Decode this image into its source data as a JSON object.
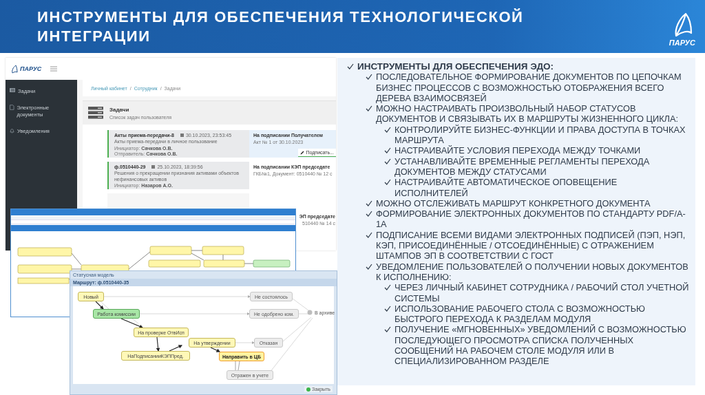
{
  "header": {
    "title": "ИНСТРУМЕНТЫ ДЛЯ ОБЕСПЕЧЕНИЯ ТЕХНОЛОГИЧЕСКОЙ ИНТЕГРАЦИИ",
    "logo_text": "ПАРУС"
  },
  "portal": {
    "logo_text": "ПАРУС",
    "sidebar": [
      {
        "label": "Задачи"
      },
      {
        "label": "Электронные документы"
      },
      {
        "label": "Уведомления"
      }
    ],
    "breadcrumb": [
      "Личный кабинет",
      "Сотрудник",
      "Задачи"
    ],
    "separator": "/",
    "panel": {
      "title": "Задачи",
      "subtitle": "Список задач пользователя"
    },
    "tasks": [
      {
        "title": "Акты приема-передачи-8",
        "date": "30.10.2023, 23:53:45",
        "description": "Акты приема-передачи в личное пользование",
        "fields": [
          {
            "label": "Инициатор:",
            "value": "Сачкова О.В."
          },
          {
            "label": "Отправитель:",
            "value": "Сачкова О.В."
          }
        ],
        "status": "На подписании Получателем",
        "detail": "Акт  № 1 от 30.10.2023",
        "action": "Подписать..."
      },
      {
        "title": "ф.0510440-29",
        "date": "25.10.2023, 18:39:56",
        "description": "Решения о прекращении признания активами объектов нефинансовых активов",
        "fields": [
          {
            "label": "Инициатор:",
            "value": "Назаров А.О."
          }
        ],
        "status": "На подписании КЭП председате",
        "detail": "ГКБ№1, Документ: 0510440 № 12 с"
      },
      {
        "status": "ЭП председате",
        "detail": "510440 № 14 с"
      }
    ]
  },
  "status_window": {
    "title": "Статусная модель",
    "route": "Маршрут: ф.0510440-35",
    "nodes": [
      {
        "label": "Новый",
        "kind": "normal"
      },
      {
        "label": "Работа комиссии",
        "kind": "done"
      },
      {
        "label": "На проверке ОтвИсп",
        "kind": "normal"
      },
      {
        "label": "На утверждении",
        "kind": "normal"
      },
      {
        "label": "НаПодписанииКЭППред.",
        "kind": "normal"
      },
      {
        "label": "Направить в ЦБ",
        "kind": "current"
      },
      {
        "label": "Отражен в учете",
        "kind": "inactive"
      },
      {
        "label": "Не состоялось",
        "kind": "inactive"
      },
      {
        "label": "Не одобрено ком.",
        "kind": "inactive"
      },
      {
        "label": "Отказан",
        "kind": "inactive"
      },
      {
        "label": "В архиве",
        "kind": "final"
      }
    ],
    "close_button": "Закрыть"
  },
  "features": [
    {
      "text": "ИНСТРУМЕНТЫ ДЛЯ ОБЕСПЕЧЕНИЯ ЭДО:",
      "children": [
        {
          "text": "ПОСЛЕДОВАТЕЛЬНОЕ ФОРМИРОВАНИЕ ДОКУМЕНТОВ ПО ЦЕПОЧКАМ БИЗНЕС ПРОЦЕССОВ С ВОЗМОЖНОСТЬЮ ОТОБРАЖЕНИЯ ВСЕГО ДЕРЕВА ВЗАИМОСВЯЗЕЙ"
        },
        {
          "text": "МОЖНО НАСТРАИВАТЬ ПРОИЗВОЛЬНЫЙ НАБОР СТАТУСОВ ДОКУМЕНТОВ И СВЯЗЫВАТЬ ИХ В МАРШРУТЫ ЖИЗНЕННОГО ЦИКЛА:",
          "children": [
            {
              "text": "КОНТРОЛИРУЙТЕ БИЗНЕС-ФУНКЦИИ И ПРАВА ДОСТУПА В ТОЧКАХ МАРШРУТА"
            },
            {
              "text": "НАСТРАИВАЙТЕ УСЛОВИЯ ПЕРЕХОДА МЕЖДУ ТОЧКАМИ"
            },
            {
              "text": "УСТАНАВЛИВАЙТЕ ВРЕМЕННЫЕ РЕГЛАМЕНТЫ ПЕРЕХОДА ДОКУМЕНТОВ МЕЖДУ СТАТУСАМИ"
            },
            {
              "text": "НАСТРАИВАЙТЕ АВТОМАТИЧЕСКОЕ ОПОВЕЩЕНИЕ ИСПОЛНИТЕЛЕЙ"
            }
          ]
        },
        {
          "text": "МОЖНО ОТСЛЕЖИВАТЬ МАРШРУТ КОНКРЕТНОГО ДОКУМЕНТА"
        },
        {
          "text": "ФОРМИРОВАНИЕ ЭЛЕКТРОННЫХ ДОКУМЕНТОВ ПО СТАНДАРТУ PDF/A-1A"
        },
        {
          "text": "ПОДПИСАНИЕ ВСЕМИ ВИДАМИ ЭЛЕКТРОННЫХ ПОДПИСЕЙ (ПЭП, НЭП, КЭП, ПРИСОЕДИНЁННЫЕ / ОТСОЕДИНЁННЫЕ) С ОТРАЖЕНИЕМ ШТАМПОВ ЭП В СООТВЕТСТВИИ С ГОСТ"
        },
        {
          "text": "УВЕДОМЛЕНИЕ ПОЛЬЗОВАТЕЛЕЙ О ПОЛУЧЕНИИ НОВЫХ ДОКУМЕНТОВ К ИСПОЛНЕНИЮ:",
          "children": [
            {
              "text": "ЧЕРЕЗ ЛИЧНЫЙ КАБИНЕТ СОТРУДНИКА / РАБОЧИЙ СТОЛ УЧЕТНОЙ СИСТЕМЫ"
            },
            {
              "text": "ИСПОЛЬЗОВАНИЕ РАБОЧЕГО СТОЛА С ВОЗМОЖНОСТЬЮ БЫСТРОГО ПЕРЕХОДА К РАЗДЕЛАМ МОДУЛЯ"
            },
            {
              "text": "ПОЛУЧЕНИЕ «МГНОВЕННЫХ» УВЕДОМЛЕНИЙ С ВОЗМОЖНОСТЬЮ ПОСЛЕДУЮЩЕГО ПРОСМОТРА СПИСКА ПОЛУЧЕННЫХ СООБЩЕНИЙ НА РАБОЧЕМ СТОЛЕ МОДУЛЯ ИЛИ В СПЕЦИАЛИЗИРОВАННОМ РАЗДЕЛЕ"
            }
          ]
        }
      ]
    }
  ]
}
